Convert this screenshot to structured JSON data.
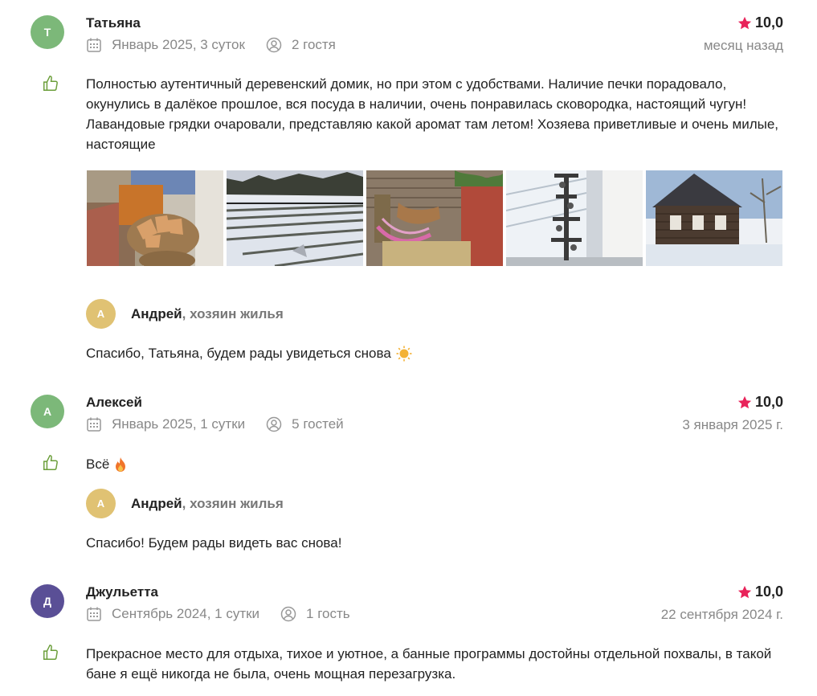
{
  "colors": {
    "star": "#e8235a",
    "like": "#6b9e3a",
    "muted": "#888888",
    "reply_avatar": "#e0c273"
  },
  "reviews": [
    {
      "avatar_letter": "Т",
      "avatar_color": "#7cb879",
      "name": "Татьяна",
      "period": "Январь 2025, 3 суток",
      "guests": "2 гостя",
      "rating": "10,0",
      "date": "месяц назад",
      "text": "Полностью аутентичный деревенский домик, но при этом с удобствами. Наличие печки порадовало, окунулись в далёкое прошлое, вся посуда в наличии, очень понравилась сковородка, настоящий чугун! Лавандовые грядки очаровали, представляю какой аромат там летом! Хозяева приветливые и очень милые, настоящие",
      "photos": [
        "firewood-basket-photo",
        "snowy-lavender-rows-photo",
        "hammock-porch-photo",
        "window-decoration-photo",
        "wooden-house-photo"
      ],
      "reply": {
        "avatar_letter": "А",
        "host_name": "Андрей",
        "host_role": ", хозяин жилья",
        "text": "Спасибо, Татьяна, будем рады увидеться снова",
        "emoji": "sun"
      }
    },
    {
      "avatar_letter": "А",
      "avatar_color": "#7cb879",
      "name": "Алексей",
      "period": "Январь 2025, 1 сутки",
      "guests": "5 гостей",
      "rating": "10,0",
      "date": "3 января 2025 г.",
      "text": "Всё",
      "text_emoji": "fire",
      "reply": {
        "avatar_letter": "А",
        "host_name": "Андрей",
        "host_role": ", хозяин жилья",
        "text": "Спасибо! Будем рады видеть вас снова!"
      }
    },
    {
      "avatar_letter": "Д",
      "avatar_color": "#5a4f96",
      "name": "Джульетта",
      "period": "Сентябрь 2024, 1 сутки",
      "guests": "1 гость",
      "rating": "10,0",
      "date": "22 сентября 2024 г.",
      "text": "Прекрасное место для отдыха, тихое и уютное, а банные программы достойны отдельной похвалы, в такой бане я ещё никогда не была, очень мощная перезагрузка."
    }
  ]
}
